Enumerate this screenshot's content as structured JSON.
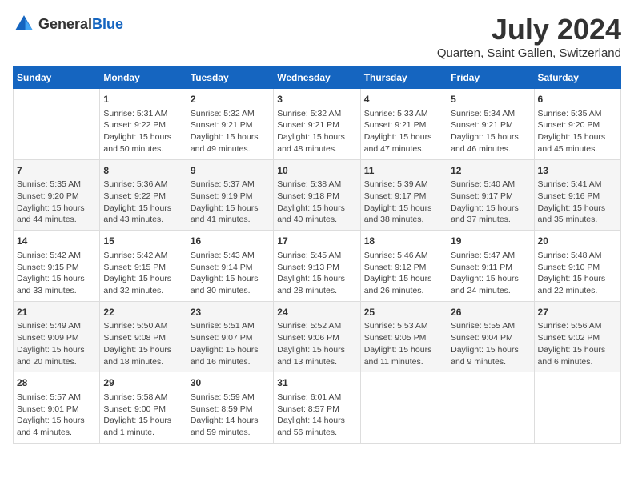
{
  "logo": {
    "text_general": "General",
    "text_blue": "Blue"
  },
  "title": "July 2024",
  "subtitle": "Quarten, Saint Gallen, Switzerland",
  "days_of_week": [
    "Sunday",
    "Monday",
    "Tuesday",
    "Wednesday",
    "Thursday",
    "Friday",
    "Saturday"
  ],
  "weeks": [
    [
      {
        "day": "",
        "info": ""
      },
      {
        "day": "1",
        "info": "Sunrise: 5:31 AM\nSunset: 9:22 PM\nDaylight: 15 hours\nand 50 minutes."
      },
      {
        "day": "2",
        "info": "Sunrise: 5:32 AM\nSunset: 9:21 PM\nDaylight: 15 hours\nand 49 minutes."
      },
      {
        "day": "3",
        "info": "Sunrise: 5:32 AM\nSunset: 9:21 PM\nDaylight: 15 hours\nand 48 minutes."
      },
      {
        "day": "4",
        "info": "Sunrise: 5:33 AM\nSunset: 9:21 PM\nDaylight: 15 hours\nand 47 minutes."
      },
      {
        "day": "5",
        "info": "Sunrise: 5:34 AM\nSunset: 9:21 PM\nDaylight: 15 hours\nand 46 minutes."
      },
      {
        "day": "6",
        "info": "Sunrise: 5:35 AM\nSunset: 9:20 PM\nDaylight: 15 hours\nand 45 minutes."
      }
    ],
    [
      {
        "day": "7",
        "info": "Sunrise: 5:35 AM\nSunset: 9:20 PM\nDaylight: 15 hours\nand 44 minutes."
      },
      {
        "day": "8",
        "info": "Sunrise: 5:36 AM\nSunset: 9:22 PM\nDaylight: 15 hours\nand 43 minutes."
      },
      {
        "day": "9",
        "info": "Sunrise: 5:37 AM\nSunset: 9:19 PM\nDaylight: 15 hours\nand 41 minutes."
      },
      {
        "day": "10",
        "info": "Sunrise: 5:38 AM\nSunset: 9:18 PM\nDaylight: 15 hours\nand 40 minutes."
      },
      {
        "day": "11",
        "info": "Sunrise: 5:39 AM\nSunset: 9:17 PM\nDaylight: 15 hours\nand 38 minutes."
      },
      {
        "day": "12",
        "info": "Sunrise: 5:40 AM\nSunset: 9:17 PM\nDaylight: 15 hours\nand 37 minutes."
      },
      {
        "day": "13",
        "info": "Sunrise: 5:41 AM\nSunset: 9:16 PM\nDaylight: 15 hours\nand 35 minutes."
      }
    ],
    [
      {
        "day": "14",
        "info": "Sunrise: 5:42 AM\nSunset: 9:15 PM\nDaylight: 15 hours\nand 33 minutes."
      },
      {
        "day": "15",
        "info": "Sunrise: 5:42 AM\nSunset: 9:15 PM\nDaylight: 15 hours\nand 32 minutes."
      },
      {
        "day": "16",
        "info": "Sunrise: 5:43 AM\nSunset: 9:14 PM\nDaylight: 15 hours\nand 30 minutes."
      },
      {
        "day": "17",
        "info": "Sunrise: 5:45 AM\nSunset: 9:13 PM\nDaylight: 15 hours\nand 28 minutes."
      },
      {
        "day": "18",
        "info": "Sunrise: 5:46 AM\nSunset: 9:12 PM\nDaylight: 15 hours\nand 26 minutes."
      },
      {
        "day": "19",
        "info": "Sunrise: 5:47 AM\nSunset: 9:11 PM\nDaylight: 15 hours\nand 24 minutes."
      },
      {
        "day": "20",
        "info": "Sunrise: 5:48 AM\nSunset: 9:10 PM\nDaylight: 15 hours\nand 22 minutes."
      }
    ],
    [
      {
        "day": "21",
        "info": "Sunrise: 5:49 AM\nSunset: 9:09 PM\nDaylight: 15 hours\nand 20 minutes."
      },
      {
        "day": "22",
        "info": "Sunrise: 5:50 AM\nSunset: 9:08 PM\nDaylight: 15 hours\nand 18 minutes."
      },
      {
        "day": "23",
        "info": "Sunrise: 5:51 AM\nSunset: 9:07 PM\nDaylight: 15 hours\nand 16 minutes."
      },
      {
        "day": "24",
        "info": "Sunrise: 5:52 AM\nSunset: 9:06 PM\nDaylight: 15 hours\nand 13 minutes."
      },
      {
        "day": "25",
        "info": "Sunrise: 5:53 AM\nSunset: 9:05 PM\nDaylight: 15 hours\nand 11 minutes."
      },
      {
        "day": "26",
        "info": "Sunrise: 5:55 AM\nSunset: 9:04 PM\nDaylight: 15 hours\nand 9 minutes."
      },
      {
        "day": "27",
        "info": "Sunrise: 5:56 AM\nSunset: 9:02 PM\nDaylight: 15 hours\nand 6 minutes."
      }
    ],
    [
      {
        "day": "28",
        "info": "Sunrise: 5:57 AM\nSunset: 9:01 PM\nDaylight: 15 hours\nand 4 minutes."
      },
      {
        "day": "29",
        "info": "Sunrise: 5:58 AM\nSunset: 9:00 PM\nDaylight: 15 hours\nand 1 minute."
      },
      {
        "day": "30",
        "info": "Sunrise: 5:59 AM\nSunset: 8:59 PM\nDaylight: 14 hours\nand 59 minutes."
      },
      {
        "day": "31",
        "info": "Sunrise: 6:01 AM\nSunset: 8:57 PM\nDaylight: 14 hours\nand 56 minutes."
      },
      {
        "day": "",
        "info": ""
      },
      {
        "day": "",
        "info": ""
      },
      {
        "day": "",
        "info": ""
      }
    ]
  ]
}
